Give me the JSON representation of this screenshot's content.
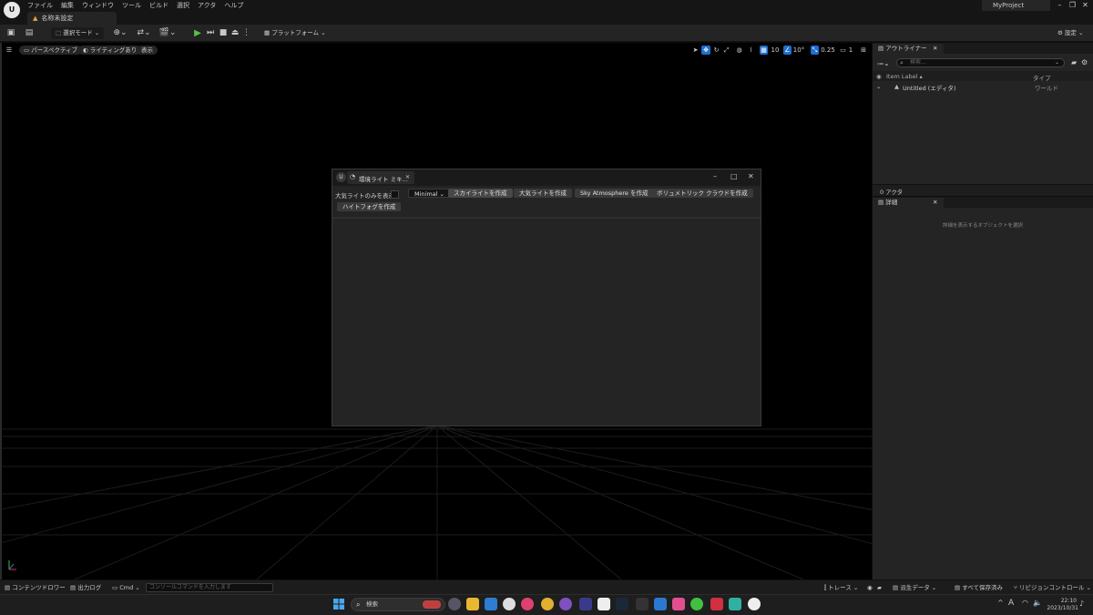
{
  "menubar": {
    "items": [
      "ファイル",
      "編集",
      "ウィンドウ",
      "ツール",
      "ビルド",
      "選択",
      "アクタ",
      "ヘルプ"
    ],
    "project": "MyProject"
  },
  "doc_tab": {
    "label": "名称未設定"
  },
  "toolbar": {
    "mode": "選択モード",
    "platform": "プラットフォーム",
    "settings": "設定"
  },
  "viewport": {
    "perspective": "パースペクティブ",
    "lighting": "ライティングあり",
    "show": "表示",
    "grid_snap": "10",
    "rot_snap": "10°",
    "scale_snap": "0.25",
    "camera_speed": "1"
  },
  "outliner": {
    "tab": "アウトライナー",
    "search_placeholder": "検索...",
    "col_label": "Item Label ▴",
    "col_type": "タイプ",
    "row_label": "Untitled (エディタ)",
    "row_type": "ワールド",
    "count": "0 アクタ"
  },
  "details": {
    "tab": "詳細",
    "empty": "詳細を表示するオブジェクトを選択"
  },
  "dialog": {
    "title": "環境ライト ミキ...",
    "checkbox_label": "大気ライトのみを表示",
    "dropdown": "Minimal",
    "buttons": [
      "スカイライトを作成",
      "大気ライトを作成",
      "Sky Atmosphere を作成",
      "ボリュメトリック クラウドを作成",
      "ハイトフォグを作成"
    ]
  },
  "statusbar": {
    "content_drawer": "コンテンツドロワー",
    "output_log": "出力ログ",
    "cmd": "Cmd",
    "cmd_placeholder": "コンソールコマンドを入力します",
    "trace": "トレース",
    "derived": "派生データ",
    "save_all": "すべて保存済み",
    "revision": "リビジョンコントロール"
  },
  "taskbar": {
    "search": "検索",
    "ime": "A",
    "time": "22:10",
    "date": "2023/10/31"
  },
  "colors": {
    "accent": "#1e6fd0",
    "play": "#59c24a",
    "warning": "#f0a030"
  }
}
